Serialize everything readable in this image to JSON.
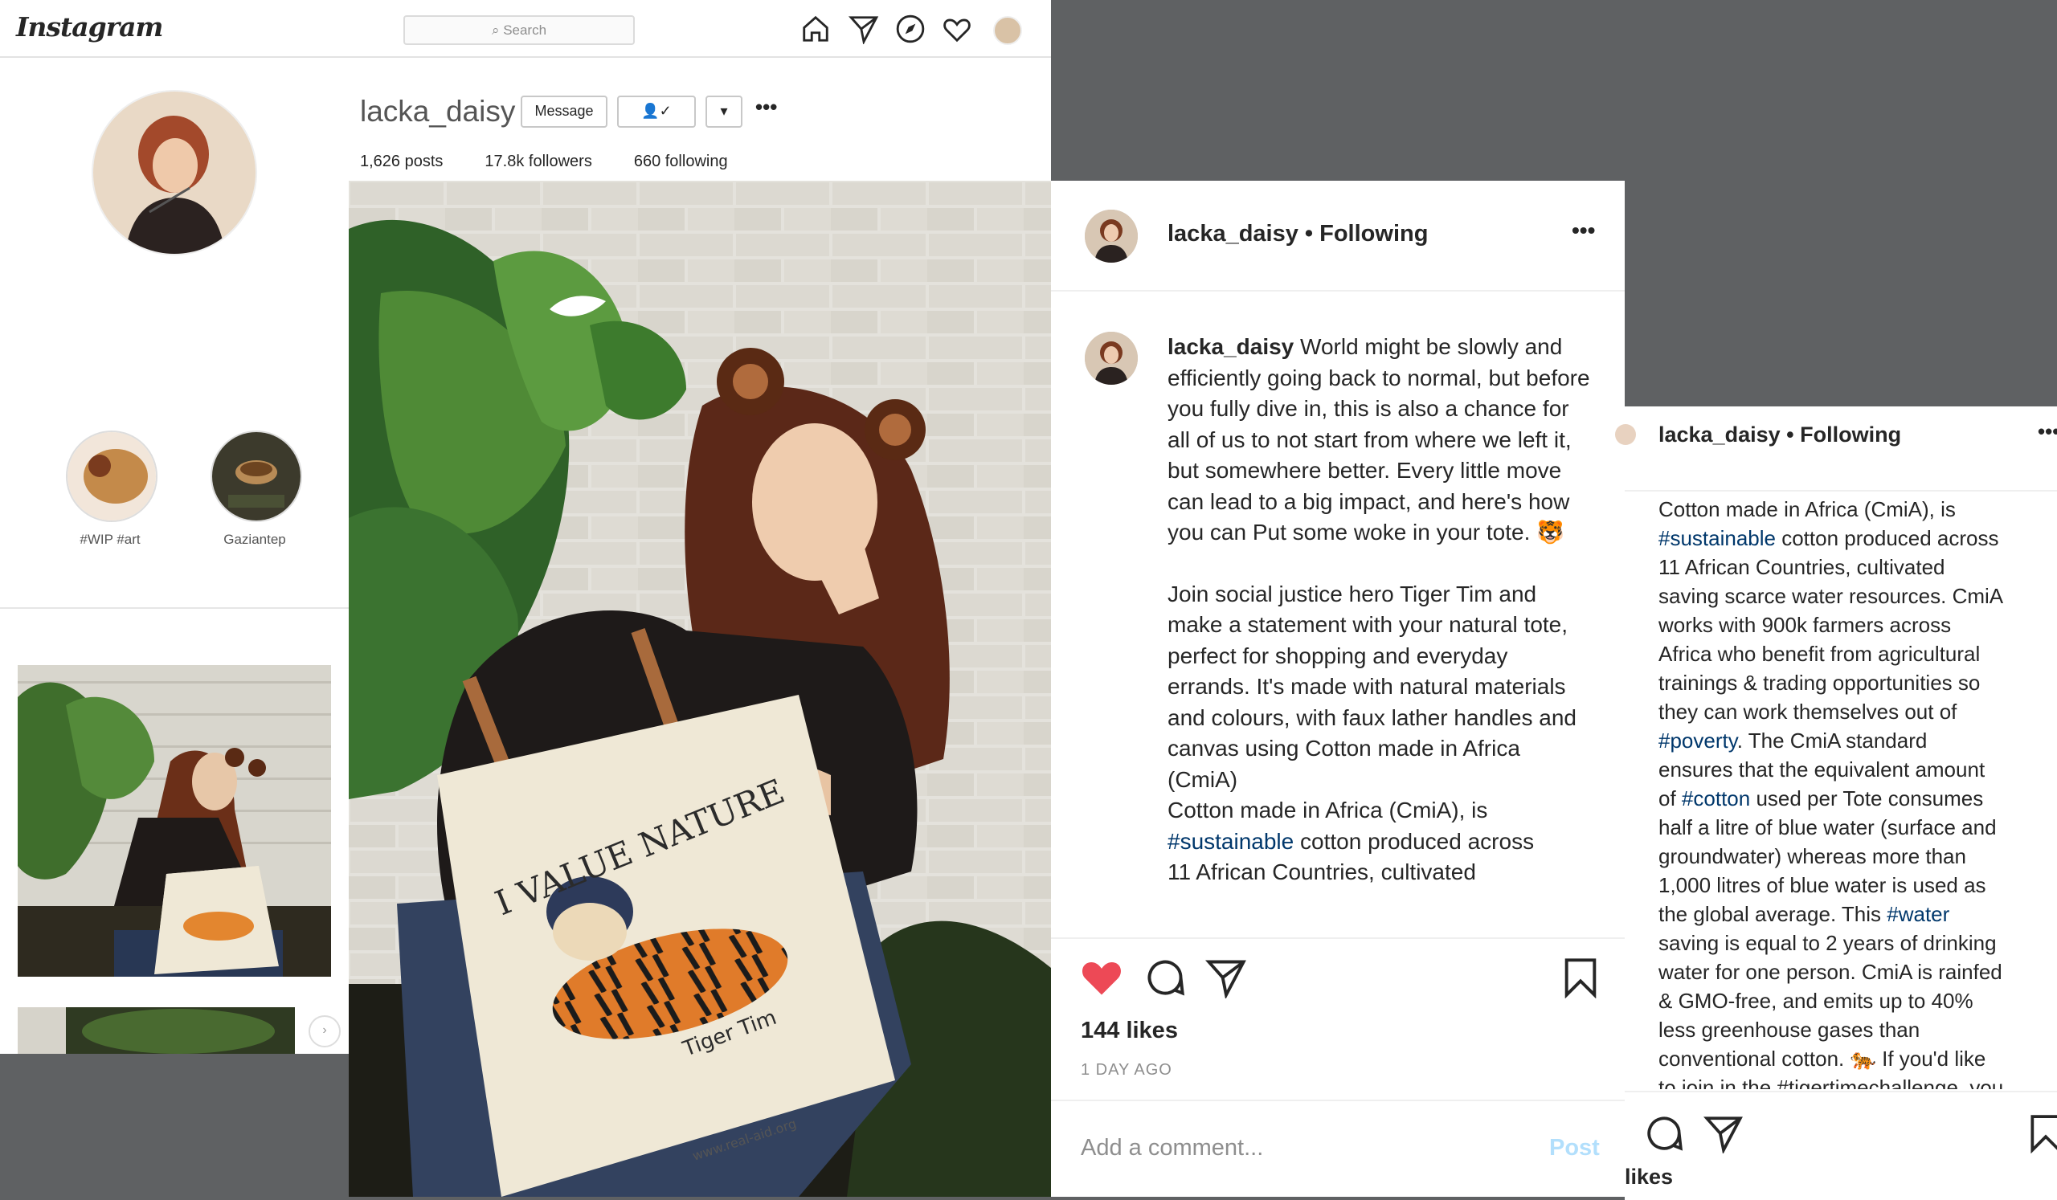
{
  "colors": {
    "like": "#ed4956",
    "link": "#00376b",
    "post_btn": "#b2dffc",
    "backdrop": "#5f6163"
  },
  "profile": {
    "logo": "Instagram",
    "search_placeholder": "Search",
    "nav_icons": [
      "home-icon",
      "direct-icon",
      "explore-icon",
      "heart-icon",
      "avatar-icon"
    ],
    "username": "lacka_daisy",
    "message_label": "Message",
    "stats": {
      "posts": "1,626 posts",
      "followers": "17.8k followers",
      "following": "660 following"
    },
    "highlights": [
      {
        "label": "#WIP #art"
      },
      {
        "label": "Gaziantep"
      }
    ]
  },
  "post": {
    "header_user": "lacka_daisy",
    "header_following": "• Following",
    "caption_user": "lacka_daisy",
    "caption_p1": "World might be slowly and efficiently going back to normal, but before you fully dive in, this is also a chance for all of us to not start from where we left it, but somewhere better. Every little move can lead to a big impact, and here's how you can Put some woke in your tote. 🐯",
    "caption_p2": "Join social justice hero Tiger Tim and make a statement with your natural tote, perfect for shopping and everyday errands. It's made with natural materials and colours, with faux lather handles and canvas using Cotton made in Africa (CmiA)",
    "caption_p3a": "Cotton made in Africa (CmiA), is",
    "caption_tag1": "#sustainable",
    "caption_p3b": "cotton produced across",
    "caption_p4": "11 African Countries, cultivated",
    "likes": "144 likes",
    "time": "1 DAY AGO",
    "comment_placeholder": "Add a comment...",
    "post_label": "Post",
    "tote_text": "I VALUE NATURE",
    "tote_brand": "Tiger Tim",
    "tote_url": "www.real-aid.org"
  },
  "third": {
    "header_user": "lacka_daisy",
    "header_following": "• Following",
    "lines": [
      "Cotton made in Africa (CmiA), is",
      [
        "#sustainable",
        " cotton produced across"
      ],
      "11 African Countries, cultivated",
      "saving scarce water resources. CmiA",
      "works with 900k farmers across",
      "Africa who benefit from agricultural",
      "trainings & trading opportunities so",
      "they can work themselves out of",
      [
        "#poverty",
        ". The CmiA standard"
      ],
      "ensures that the equivalent amount",
      [
        "of ",
        "#cotton",
        " used per Tote consumes"
      ],
      "half a litre of blue water (surface and",
      "groundwater) whereas more than",
      "1,000 litres of blue water is used as",
      [
        "the global average. This ",
        "#water"
      ],
      "saving is equal to 2 years of drinking",
      "water for one person. CmiA is rainfed",
      "& GMO-free, and emits up to 40%",
      "less greenhouse gases than",
      "conventional cotton. 🐅 If you'd like",
      "to join in the #tigertimechallenge, you"
    ],
    "likes_label": "likes"
  }
}
